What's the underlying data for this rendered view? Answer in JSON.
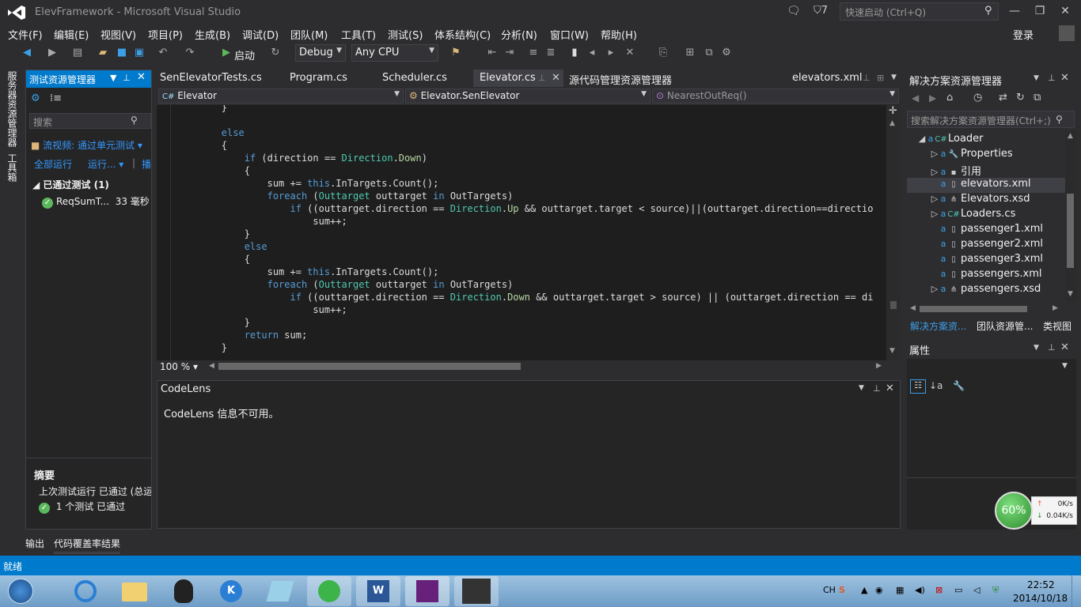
{
  "window": {
    "title": "ElevFramework - Microsoft Visual Studio",
    "notifications_count": "7",
    "quick_launch_placeholder": "快速启动 (Ctrl+Q)"
  },
  "menu": [
    "文件(F)",
    "编辑(E)",
    "视图(V)",
    "项目(P)",
    "生成(B)",
    "调试(D)",
    "团队(M)",
    "工具(T)",
    "测试(S)",
    "体系结构(C)",
    "分析(N)",
    "窗口(W)",
    "帮助(H)"
  ],
  "login_label": "登录",
  "toolbar": {
    "start_label": "启动",
    "config": "Debug",
    "platform": "Any CPU"
  },
  "left_strip": {
    "server_explorer": "服务器资源管理器",
    "toolbox": "工具箱"
  },
  "test_explorer": {
    "title": "测试资源管理器",
    "search_placeholder": "搜索",
    "playlist": "流视频: 通过单元测试",
    "run_all": "全部运行",
    "run": "运行...",
    "separator": "|",
    "more": "播",
    "passed_group": "已通过测试 (1)",
    "test_name": "ReqSumT...",
    "test_time": "33 毫秒",
    "summary_title": "摘要",
    "summary_last_run": "上次测试运行 已通过 (总运",
    "summary_count": "1 个测试 已通过"
  },
  "doc_tabs": [
    "SenElevatorTests.cs",
    "Program.cs",
    "Scheduler.cs",
    "Elevator.cs",
    "源代码管理资源管理器",
    "elevators.xml"
  ],
  "nav": {
    "project": "Elevator",
    "type": "Elevator.SenElevator",
    "member": "NearestOutReq()"
  },
  "code_lines": [
    "        }",
    "",
    "        else",
    "        {",
    "            if (direction == Direction.Down)",
    "            {",
    "                sum += this.InTargets.Count();",
    "                foreach (Outtarget outtarget in OutTargets)",
    "                    if ((outtarget.direction == Direction.Up && outtarget.target < source)||(outtarget.direction==directio",
    "                        sum++;",
    "            }",
    "            else",
    "            {",
    "                sum += this.InTargets.Count();",
    "                foreach (Outtarget outtarget in OutTargets)",
    "                    if ((outtarget.direction == Direction.Down && outtarget.target > source) || (outtarget.direction == di",
    "                        sum++;",
    "            }",
    "            return sum;",
    "        }"
  ],
  "editor": {
    "zoom": "100 %"
  },
  "codelens": {
    "title": "CodeLens",
    "message": "CodeLens 信息不可用。"
  },
  "solution_explorer": {
    "title": "解决方案资源管理器",
    "search_placeholder": "搜索解决方案资源管理器(Ctrl+;)",
    "items": [
      {
        "label": "Loader",
        "icon": "C#",
        "expander": "◢"
      },
      {
        "label": "Properties",
        "icon": "🔧",
        "expander": "▷"
      },
      {
        "label": "引用",
        "icon": "▪",
        "expander": "▷"
      },
      {
        "label": "elevators.xml",
        "icon": "▯",
        "expander": ""
      },
      {
        "label": "Elevators.xsd",
        "icon": "⋔",
        "expander": "▷"
      },
      {
        "label": "Loaders.cs",
        "icon": "C#",
        "expander": "▷"
      },
      {
        "label": "passenger1.xml",
        "icon": "▯",
        "expander": ""
      },
      {
        "label": "passenger2.xml",
        "icon": "▯",
        "expander": ""
      },
      {
        "label": "passenger3.xml",
        "icon": "▯",
        "expander": ""
      },
      {
        "label": "passengers.xml",
        "icon": "▯",
        "expander": ""
      },
      {
        "label": "passengers.xsd",
        "icon": "⋔",
        "expander": "▷"
      }
    ],
    "tabs": [
      "解决方案资...",
      "团队资源管...",
      "类视图"
    ]
  },
  "properties": {
    "title": "属性"
  },
  "net_widget": {
    "percent": "60%",
    "up": "0K/s",
    "down": "0.04K/s"
  },
  "bottom_tabs": [
    "输出",
    "代码覆盖率结果"
  ],
  "status": "就绪",
  "taskbar": {
    "ime": "CH",
    "time": "22:52",
    "date": "2014/10/18"
  },
  "colors": {
    "accent": "#007acc",
    "editor_bg": "#1e1e1e",
    "keyword": "#569cd6",
    "type": "#4ec9b0"
  }
}
